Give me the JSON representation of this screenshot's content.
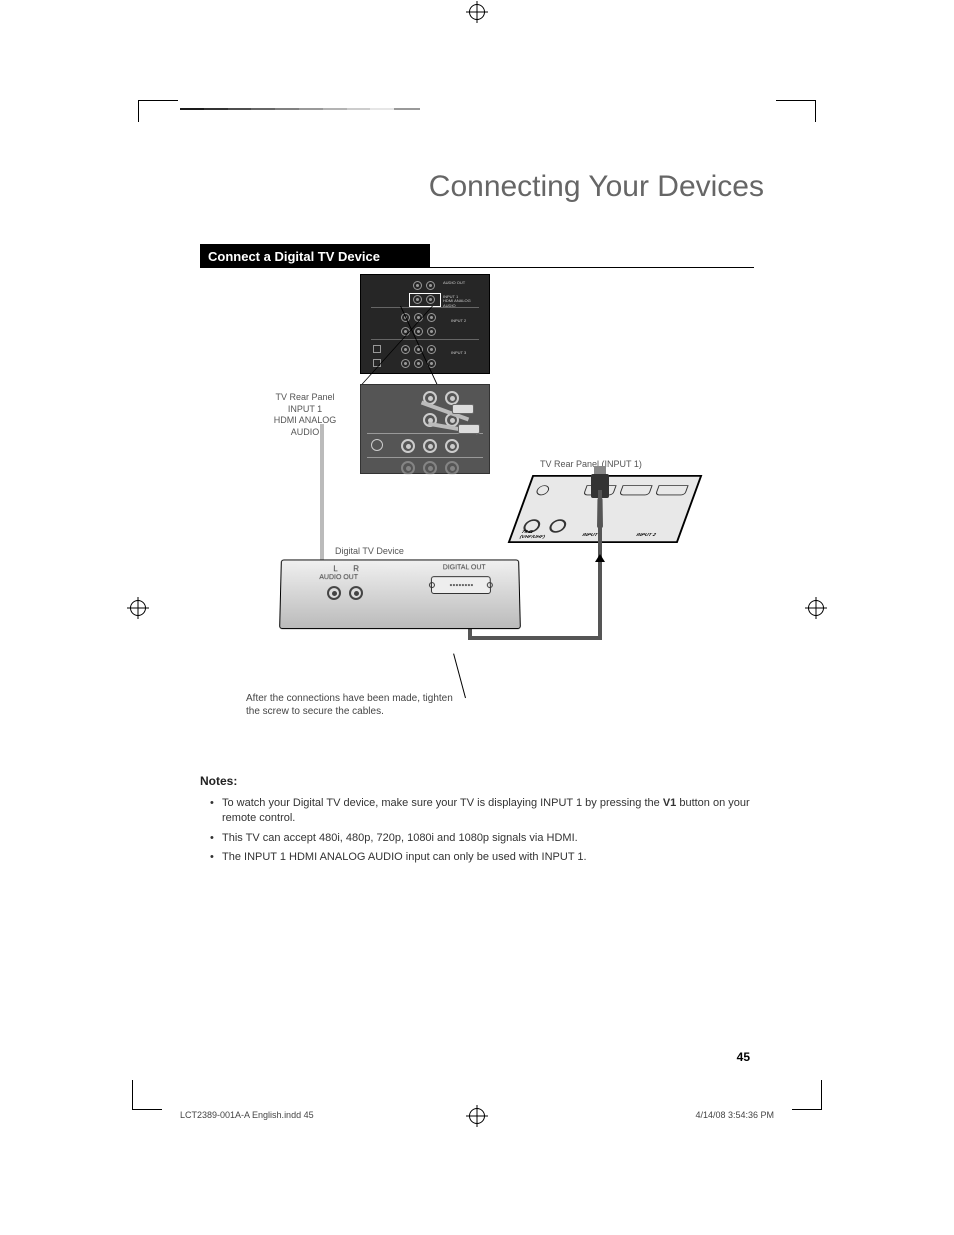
{
  "page_title": "Connecting Your Devices",
  "section_header": "Connect a Digital TV Device",
  "small_panel_labels": {
    "audio_out": "AUDIO OUT",
    "input1": "INPUT 1\nHDMI ANALOG\nAUDIO",
    "input2": "INPUT 2",
    "input3": "INPUT 3"
  },
  "label_left": {
    "l1": "TV Rear Panel",
    "l2": "INPUT 1",
    "l3": "HDMI ANALOG",
    "l4": "AUDIO"
  },
  "hdmi_label": "TV Rear Panel (INPUT 1)",
  "hdmi_panel": {
    "input1": "INPUT 1",
    "input2": "INPUT 2",
    "ohm": "75 Ω\n(VHF/UHF)"
  },
  "dtv_label": "Digital TV Device",
  "dtv": {
    "L": "L",
    "R": "R",
    "audio_out": "AUDIO OUT",
    "digital_out": "DIGITAL OUT"
  },
  "callout": "After the connections have been made, tighten the screw to secure the cables.",
  "notes_heading": "Notes:",
  "notes": [
    {
      "pre": "To watch your Digital TV device, make sure your TV is displaying INPUT 1 by pressing the ",
      "bold": "V1",
      "post": " button on your remote control."
    },
    {
      "pre": "This TV can accept 480i, 480p, 720p, 1080i and 1080p signals via HDMI.",
      "bold": "",
      "post": ""
    },
    {
      "pre": "The INPUT 1 HDMI ANALOG AUDIO input can only be used with INPUT 1.",
      "bold": "",
      "post": ""
    }
  ],
  "page_number": "45",
  "footer_left": "LCT2389-001A-A English.indd   45",
  "footer_right": "4/14/08   3:54:36 PM"
}
